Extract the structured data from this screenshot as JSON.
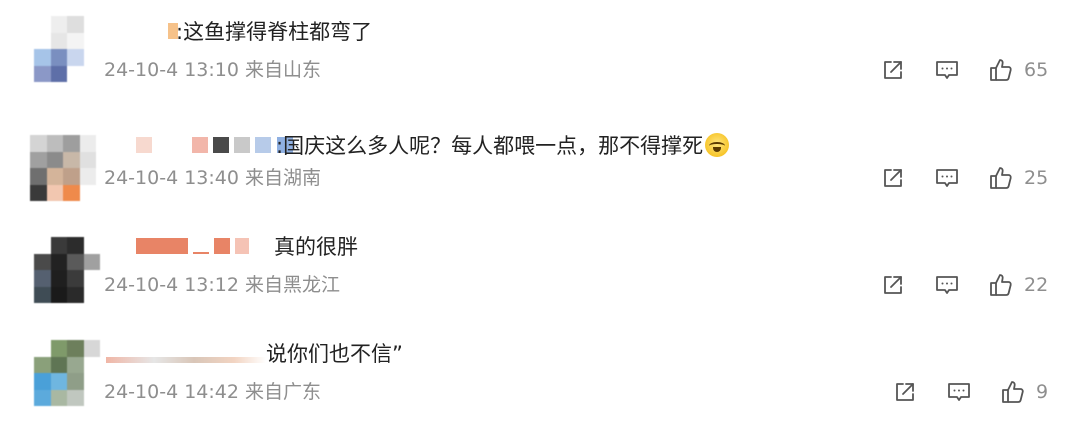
{
  "comments": [
    {
      "text": ":这鱼撑得脊柱都弯了",
      "meta": "24-10-4 13:10 来自山东",
      "likes": "65",
      "avatar_colors": [
        "#ffffff",
        "#f0f0f0",
        "#dcdcdc",
        "#ffffff",
        "#ffffff",
        "#e6e6e6",
        "#f2f2f2",
        "#ffffff",
        "#a6c4e8",
        "#7a8fc0",
        "#c9d6ee",
        "#ffffff",
        "#8b98c7",
        "#5e6fa8",
        "#ffffff",
        "#ffffff"
      ]
    },
    {
      "text": ":国庆这么多人呢？每人都喂一点，那不得撑死",
      "meta": "24-10-4 13:40 来自湖南",
      "likes": "25",
      "avatar_colors": [
        "#cfcfcf",
        "#bdbdbd",
        "#9e9e9e",
        "#e8e8e8",
        "#a0a0a0",
        "#8b8b8b",
        "#c8b8a8",
        "#e0e0e0",
        "#6f6f6f",
        "#d4b49a",
        "#bfa08a",
        "#ececec",
        "#3a3a3a",
        "#f2c7b0",
        "#ef8a4b",
        "#ffffff"
      ]
    },
    {
      "text": "真的很胖",
      "meta": "24-10-4 13:12 来自黑龙江",
      "likes": "22",
      "avatar_colors": [
        "#ffffff",
        "#3a3a3a",
        "#2c2c2c",
        "#ffffff",
        "#4a4a4a",
        "#222222",
        "#5a5a5a",
        "#a0a0a0",
        "#556070",
        "#1f1f1f",
        "#3b3b3b",
        "#ffffff",
        "#3f4c55",
        "#1a1a1a",
        "#2a2a2a",
        "#ffffff"
      ]
    },
    {
      "text": "说你们也不信”",
      "meta": "24-10-4 14:42 来自广东",
      "likes": "9",
      "avatar_colors": [
        "#ffffff",
        "#7f9a6a",
        "#6d7f5c",
        "#d7d7d7",
        "#8aa07a",
        "#5f7554",
        "#98a890",
        "#ffffff",
        "#4aa0d8",
        "#6fb6e0",
        "#8f9e88",
        "#ffffff",
        "#5caadc",
        "#a9b8a2",
        "#c0c7bf",
        "#ffffff"
      ]
    }
  ]
}
